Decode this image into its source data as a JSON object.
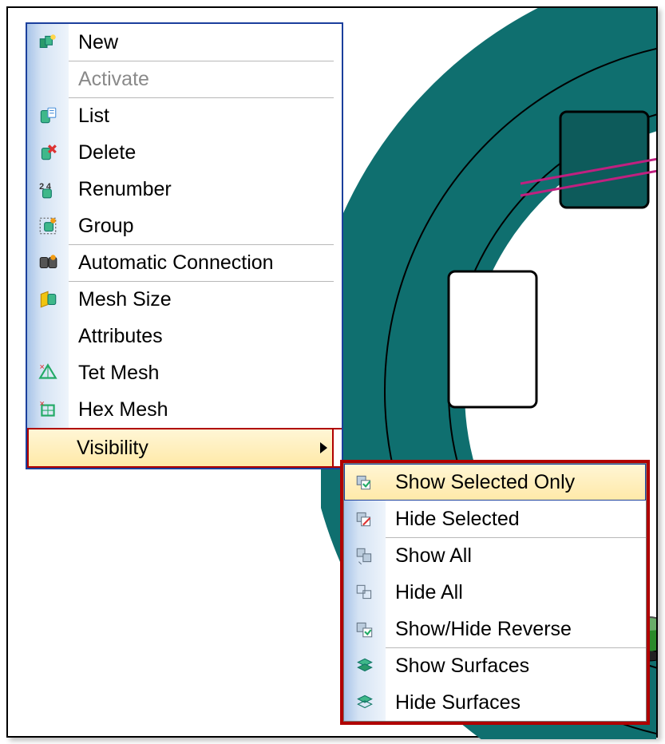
{
  "main_menu": {
    "items": [
      {
        "label": "New",
        "icon": "new-icon",
        "disabled": false,
        "sep": false
      },
      {
        "label": "Activate",
        "icon": "",
        "disabled": true,
        "sep": true
      },
      {
        "label": "List",
        "icon": "list-icon",
        "disabled": false,
        "sep": true
      },
      {
        "label": "Delete",
        "icon": "delete-icon",
        "disabled": false,
        "sep": false
      },
      {
        "label": "Renumber",
        "icon": "renumber-icon",
        "disabled": false,
        "sep": false
      },
      {
        "label": "Group",
        "icon": "group-icon",
        "disabled": false,
        "sep": false
      },
      {
        "label": "Automatic Connection",
        "icon": "auto-connection-icon",
        "disabled": false,
        "sep": true
      },
      {
        "label": "Mesh Size",
        "icon": "mesh-size-icon",
        "disabled": false,
        "sep": true
      },
      {
        "label": "Attributes",
        "icon": "",
        "disabled": false,
        "sep": false
      },
      {
        "label": "Tet Mesh",
        "icon": "tet-mesh-icon",
        "disabled": false,
        "sep": false
      },
      {
        "label": "Hex Mesh",
        "icon": "hex-mesh-icon",
        "disabled": false,
        "sep": false
      },
      {
        "label": "Visibility",
        "icon": "",
        "disabled": false,
        "sep": true,
        "highlight": true,
        "submenu": true
      }
    ]
  },
  "sub_menu": {
    "items": [
      {
        "label": "Show Selected Only",
        "icon": "show-selected-icon",
        "sep": false,
        "highlight": true
      },
      {
        "label": "Hide Selected",
        "icon": "hide-selected-icon",
        "sep": false
      },
      {
        "label": "Show All",
        "icon": "show-all-icon",
        "sep": true
      },
      {
        "label": "Hide All",
        "icon": "hide-all-icon",
        "sep": false
      },
      {
        "label": "Show/Hide Reverse",
        "icon": "reverse-icon",
        "sep": false
      },
      {
        "label": "Show Surfaces",
        "icon": "show-surfaces-icon",
        "sep": true
      },
      {
        "label": "Hide Surfaces",
        "icon": "hide-surfaces-icon",
        "sep": false
      }
    ]
  },
  "colors": {
    "menu_border": "#1b3f9c",
    "highlight_border": "#b00000",
    "model_fill": "#0f6f6f"
  }
}
